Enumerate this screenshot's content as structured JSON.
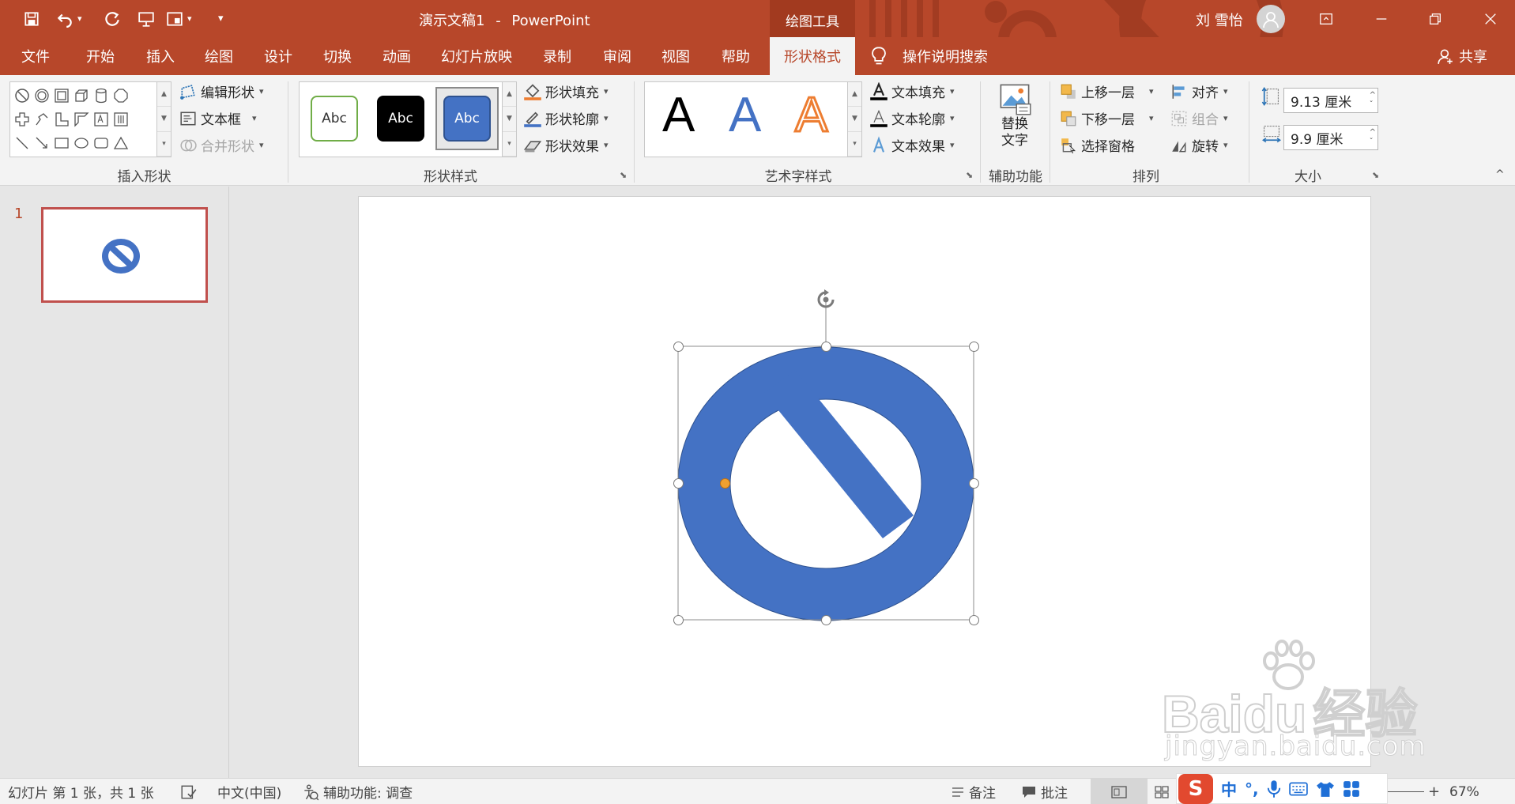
{
  "window": {
    "doc_name": "演示文稿1",
    "separator": "-",
    "app_name": "PowerPoint",
    "contextual_group": "绘图工具",
    "user_name": "刘 雪怡",
    "accent": "#b7472a"
  },
  "tabs": [
    {
      "label": "文件"
    },
    {
      "label": "开始"
    },
    {
      "label": "插入"
    },
    {
      "label": "绘图"
    },
    {
      "label": "设计"
    },
    {
      "label": "切换"
    },
    {
      "label": "动画"
    },
    {
      "label": "幻灯片放映"
    },
    {
      "label": "录制"
    },
    {
      "label": "审阅"
    },
    {
      "label": "视图"
    },
    {
      "label": "帮助"
    },
    {
      "label": "形状格式",
      "active": true
    }
  ],
  "tell_me": "操作说明搜索",
  "share": "共享",
  "ribbon": {
    "insert_shapes": {
      "label": "插入形状",
      "edit_shape": "编辑形状",
      "text_box": "文本框",
      "merge_shapes": "合并形状"
    },
    "shape_styles": {
      "label": "形状样式",
      "thumb_text": "Abc",
      "fill": "形状填充",
      "outline": "形状轮廓",
      "effects": "形状效果"
    },
    "wordart_styles": {
      "label": "艺术字样式",
      "sample": "A",
      "text_fill": "文本填充",
      "text_outline": "文本轮廓",
      "text_effects": "文本效果"
    },
    "accessibility": {
      "label": "辅助功能",
      "alt_text_line1": "替换",
      "alt_text_line2": "文字"
    },
    "arrange": {
      "label": "排列",
      "bring_forward": "上移一层",
      "send_backward": "下移一层",
      "selection_pane": "选择窗格",
      "align": "对齐",
      "group": "组合",
      "rotate": "旋转"
    },
    "size": {
      "label": "大小",
      "height": "9.13 厘米",
      "width": "9.9 厘米"
    }
  },
  "slides": {
    "current_number": "1"
  },
  "shape": {
    "name": "no-symbol",
    "fill_color": "#4472c4"
  },
  "statusbar": {
    "slide_info": "幻灯片 第 1 张，共 1 张",
    "language": "中文(中国)",
    "accessibility": "辅助功能: 调查",
    "notes": "备注",
    "comments": "批注",
    "zoom": "67%"
  },
  "ime": {
    "logo": "S",
    "mode": "中",
    "punct": "°,"
  },
  "watermark": {
    "brand_a": "Bai",
    "brand_b": "du",
    "brand_c": "经验",
    "url": "jingyan.baidu.com"
  }
}
